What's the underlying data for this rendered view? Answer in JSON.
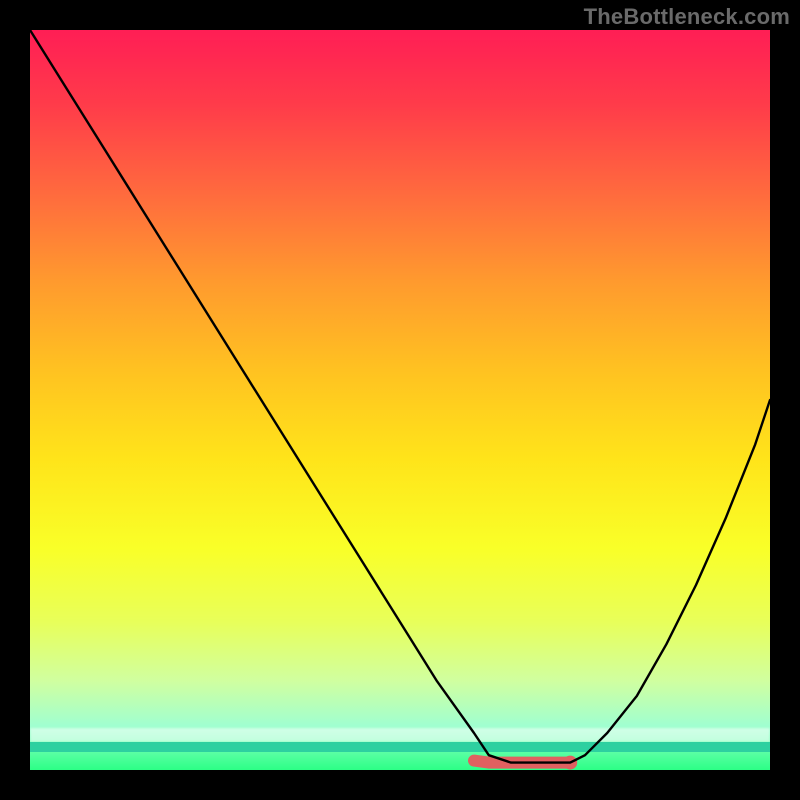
{
  "branding": {
    "watermark": "TheBottleneck.com"
  },
  "chart_data": {
    "type": "line",
    "title": "",
    "xlabel": "",
    "ylabel": "",
    "xlim": [
      0,
      100
    ],
    "ylim": [
      0,
      100
    ],
    "grid": false,
    "legend": false,
    "series": [
      {
        "name": "bottleneck-curve",
        "x": [
          0,
          5,
          10,
          15,
          20,
          25,
          30,
          35,
          40,
          45,
          50,
          55,
          60,
          62,
          65,
          70,
          73,
          75,
          78,
          82,
          86,
          90,
          94,
          98,
          100
        ],
        "values": [
          100,
          92,
          84,
          76,
          68,
          60,
          52,
          44,
          36,
          28,
          20,
          12,
          5,
          2,
          1,
          1,
          1,
          2,
          5,
          10,
          17,
          25,
          34,
          44,
          50
        ]
      }
    ],
    "highlight_segment": {
      "comment": "flat valley marked in salmon",
      "x_start": 60,
      "x_end": 73,
      "y": 1
    },
    "marker_point": {
      "x": 73,
      "y": 1
    },
    "background_gradient": {
      "top_color": "#ff1e55",
      "mid_color": "#ffe41a",
      "bottom_color": "#2cff86"
    }
  }
}
